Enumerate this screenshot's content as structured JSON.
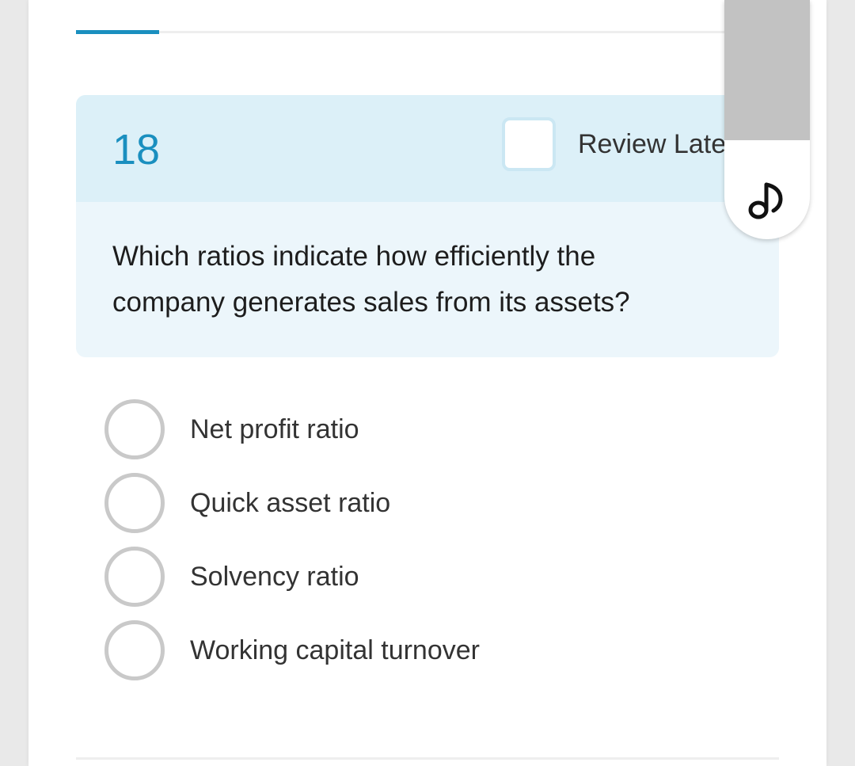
{
  "progress": {
    "fraction": 0.118
  },
  "question": {
    "number": "18",
    "review_label": "Review Late",
    "text": "Which ratios indicate how efficiently the company generates sales from its assets?"
  },
  "options": [
    {
      "label": "Net profit ratio",
      "selected": false
    },
    {
      "label": "Quick asset ratio",
      "selected": false
    },
    {
      "label": "Solvency ratio",
      "selected": false
    },
    {
      "label": "Working capital turnover",
      "selected": false
    }
  ],
  "scrollbar": {
    "icon": "music-note-icon"
  },
  "colors": {
    "accent": "#1a8fbf",
    "header_bg": "#dcf0f8",
    "question_bg": "#ecf6fb"
  }
}
